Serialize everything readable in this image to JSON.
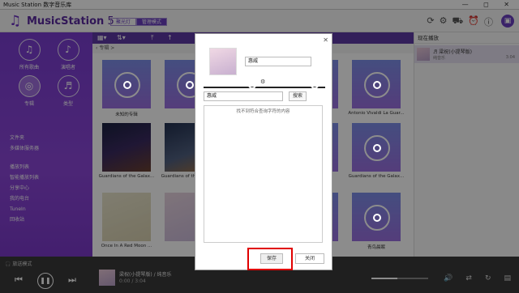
{
  "window": {
    "title": "Music Station 数字音乐库",
    "controls": "— ◻ ✕"
  },
  "header": {
    "logo": "MusicStation",
    "logo_version": " 5",
    "tabs": [
      {
        "label": "聚光灯",
        "active": false
      },
      {
        "label": "管理模式",
        "active": true
      }
    ],
    "icons": [
      "refresh-icon",
      "settings-icon",
      "car-icon",
      "alarm-icon",
      "info-icon"
    ]
  },
  "sidebar": {
    "grid": [
      {
        "label": "所有歌曲",
        "icon": "♫"
      },
      {
        "label": "演唱者",
        "icon": "♪"
      },
      {
        "label": "专辑",
        "icon": "◎",
        "active": true
      },
      {
        "label": "类型",
        "icon": "♬"
      }
    ],
    "list_a": [
      "文件夹",
      "多媒体服务器"
    ],
    "list_b": [
      "播放列表",
      "智能播放列表",
      "分享中心",
      "我的电台",
      "TuneIn",
      "回收站"
    ]
  },
  "breadcrumb": "专辑 >",
  "albums": [
    {
      "label": "未知的专辑",
      "cover": "placeholder"
    },
    {
      "label": "",
      "cover": "placeholder"
    },
    {
      "label": "",
      "cover": "placeholder"
    },
    {
      "label": "",
      "cover": "placeholder"
    },
    {
      "label": "Antonio Vivaldi La Guar...",
      "cover": "placeholder"
    },
    {
      "label": "Guardians of the Galax...",
      "cover": "dark"
    },
    {
      "label": "Guardians of the Galax...",
      "cover": "dark2"
    },
    {
      "label": "",
      "cover": "placeholder"
    },
    {
      "label": "",
      "cover": "placeholder"
    },
    {
      "label": "Guardians of the Galax...",
      "cover": "placeholder"
    },
    {
      "label": "Once In A Red Moon ...",
      "cover": "cream"
    },
    {
      "label": "",
      "cover": "pinkish"
    },
    {
      "label": "",
      "cover": "placeholder"
    },
    {
      "label": "",
      "cover": "placeholder"
    },
    {
      "label": "青鸟晨眠",
      "cover": "placeholder"
    }
  ],
  "right_panel": {
    "title": "现在播放",
    "item": {
      "title": "♬ 梁祝(小提琴版)",
      "artist": "纯音乐",
      "time": "3:04"
    }
  },
  "player": {
    "mode": "旅送模式",
    "track": "梁祝(小提琴版) / 纯音乐",
    "time": "0:00 / 3:04",
    "volume_fraction": 0.45
  },
  "dialog": {
    "name_value": "惠威",
    "search_value": "惠威",
    "search_button": "搜索",
    "no_result": "找不到符合查询字符的内容",
    "save_label": "保存",
    "cancel_label": "关闭",
    "highlight_color": "#e00000"
  }
}
